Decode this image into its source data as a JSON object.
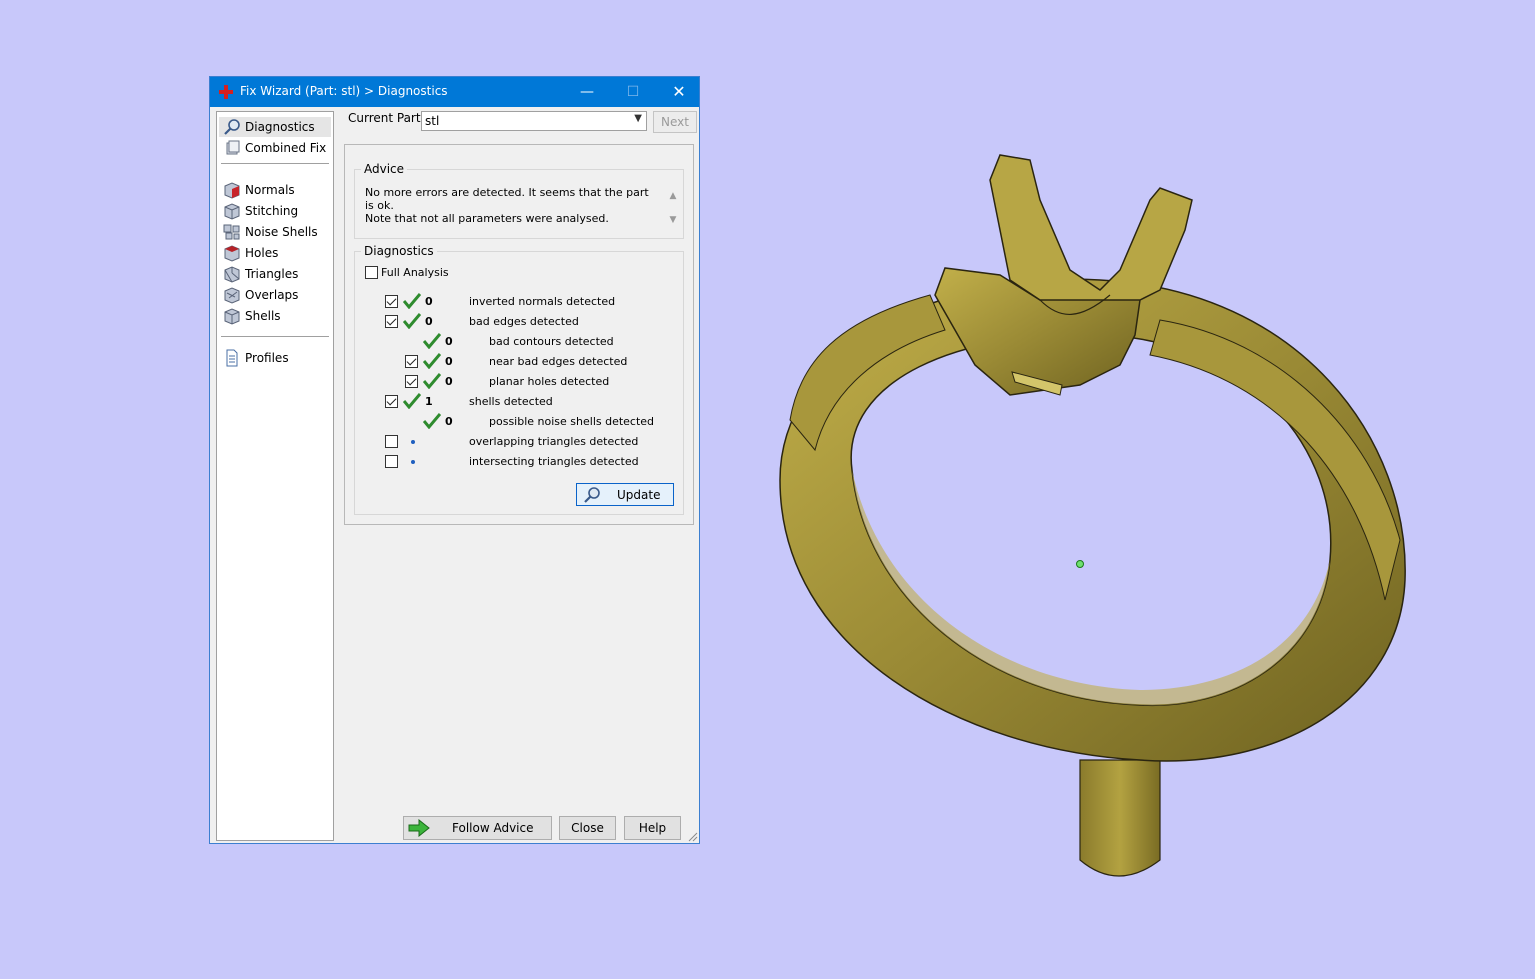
{
  "window": {
    "title": "Fix Wizard (Part: stl) > Diagnostics",
    "app_icon": "red-cross-icon",
    "controls": {
      "minimize": "—",
      "maximize": "☐",
      "close": "✕"
    }
  },
  "nav": {
    "groups": [
      [
        {
          "label": "Diagnostics",
          "icon": "magnifier-icon",
          "active": true
        },
        {
          "label": "Combined Fix",
          "icon": "cubes-icon",
          "active": false
        }
      ],
      [
        {
          "label": "Normals",
          "icon": "cube-normals-icon"
        },
        {
          "label": "Stitching",
          "icon": "cube-stitching-icon"
        },
        {
          "label": "Noise Shells",
          "icon": "cube-noise-icon"
        },
        {
          "label": "Holes",
          "icon": "cube-holes-icon"
        },
        {
          "label": "Triangles",
          "icon": "cube-triangles-icon"
        },
        {
          "label": "Overlaps",
          "icon": "cube-overlaps-icon"
        },
        {
          "label": "Shells",
          "icon": "cube-shells-icon"
        }
      ],
      [
        {
          "label": "Profiles",
          "icon": "document-icon"
        }
      ]
    ]
  },
  "current_part": {
    "label": "Current Part:",
    "value": "stl",
    "next_label": "Next"
  },
  "advice": {
    "title": "Advice",
    "line1": "No more errors are detected. It seems that the part is ok.",
    "line2": "Note that not all parameters were analysed."
  },
  "diagnostics": {
    "title": "Diagnostics",
    "full_analysis_label": "Full Analysis",
    "full_analysis_checked": false,
    "rows": [
      {
        "checkbox": "checked",
        "status": "ok",
        "count": "0",
        "label": "inverted normals detected",
        "indent": 0
      },
      {
        "checkbox": "checked",
        "status": "ok",
        "count": "0",
        "label": "bad edges detected",
        "indent": 0
      },
      {
        "checkbox": "none",
        "status": "ok",
        "count": "0",
        "label": "bad contours detected",
        "indent": 1
      },
      {
        "checkbox": "checked",
        "status": "ok",
        "count": "0",
        "label": "near bad edges detected",
        "indent": 1
      },
      {
        "checkbox": "checked",
        "status": "ok",
        "count": "0",
        "label": "planar holes detected",
        "indent": 1
      },
      {
        "checkbox": "checked",
        "status": "ok",
        "count": "1",
        "label": "shells detected",
        "indent": 0
      },
      {
        "checkbox": "none",
        "status": "ok",
        "count": "0",
        "label": "possible noise shells detected",
        "indent": 1
      },
      {
        "checkbox": "unchecked",
        "status": "pending",
        "count": "",
        "label": "overlapping triangles detected",
        "indent": 0
      },
      {
        "checkbox": "unchecked",
        "status": "pending",
        "count": "",
        "label": "intersecting triangles detected",
        "indent": 0
      }
    ],
    "update_label": "Update"
  },
  "buttons": {
    "follow_advice": "Follow Advice",
    "close": "Close",
    "help": "Help"
  },
  "colors": {
    "background": "#c8c8fa",
    "titlebar": "#0078d7",
    "model_gold": "#9a8a35",
    "check_green": "#2e8b2e"
  }
}
